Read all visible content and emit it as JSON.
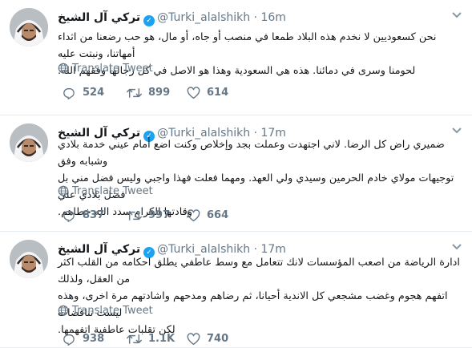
{
  "tweets": [
    {
      "name": "تركي آل الشيخ",
      "handle": "@Turki_alalshikh",
      "separator": "·",
      "time": "16m",
      "lines": [
        "نحن كسعوديين لا نخدم هذه البلاد طمعا في منصب أو جاه، أو مال، هو حب رضعنا من اثداء أمهاتنا، ونبتت عليه",
        "لحومنا وسرى في دمائنا. هذه هي السعودية وهذا هو الاصل في كل رجالها وفقهم الله."
      ],
      "translate": "Translate Tweet",
      "replies": "524",
      "retweets": "899",
      "likes": "614"
    },
    {
      "name": "تركي آل الشيخ",
      "handle": "@Turki_alalshikh",
      "separator": "·",
      "time": "17m",
      "lines": [
        "ضميري راض كل الرضا. لاني اجتهدت وعملت بجد وإخلاص وكنت اضع أمام عيني خدمة بلادي وشبابه وفق",
        "توجيهات مولاي خادم الحرمين وسيدي ولي العهد. ومهما فعلت فهذا واجبي وليس فضل مني بل فضل بلادي علي",
        "وقادتها الكرام سدد الله خطاهم."
      ],
      "translate": "Translate Tweet",
      "replies": "837",
      "retweets": "997",
      "likes": "664"
    },
    {
      "name": "تركي آل الشيخ",
      "handle": "@Turki_alalshikh",
      "separator": "·",
      "time": "17m",
      "lines": [
        "ادارة الرياضة من اصعب المؤسسات لانك تتعامل مع وسط عاطفي يطلق احكامه من القلب اكثر من العقل، ولذلك",
        "اتفهم هجوم وغضب مشجعي كل الاندية أحيانا، ثم رضاهم ومدحهم واشادتهم مرة اخرى، وهذه ليست تناقضات",
        "لكن تقلبات عاطفية اتفهمها."
      ],
      "translate": "Translate Tweet",
      "replies": "938",
      "retweets": "1.1K",
      "likes": "740"
    }
  ],
  "colors": {
    "text": "#14171a",
    "muted": "#657786",
    "verified": "#1da1f2",
    "divider": "#e6ecf0"
  },
  "icons": {
    "avatar": "avatar-person-in-ghutra",
    "verified": "verified-badge-icon",
    "caret": "chevron-down-icon",
    "translate": "globe-icon",
    "reply": "reply-icon",
    "retweet": "retweet-icon",
    "like": "heart-icon"
  }
}
